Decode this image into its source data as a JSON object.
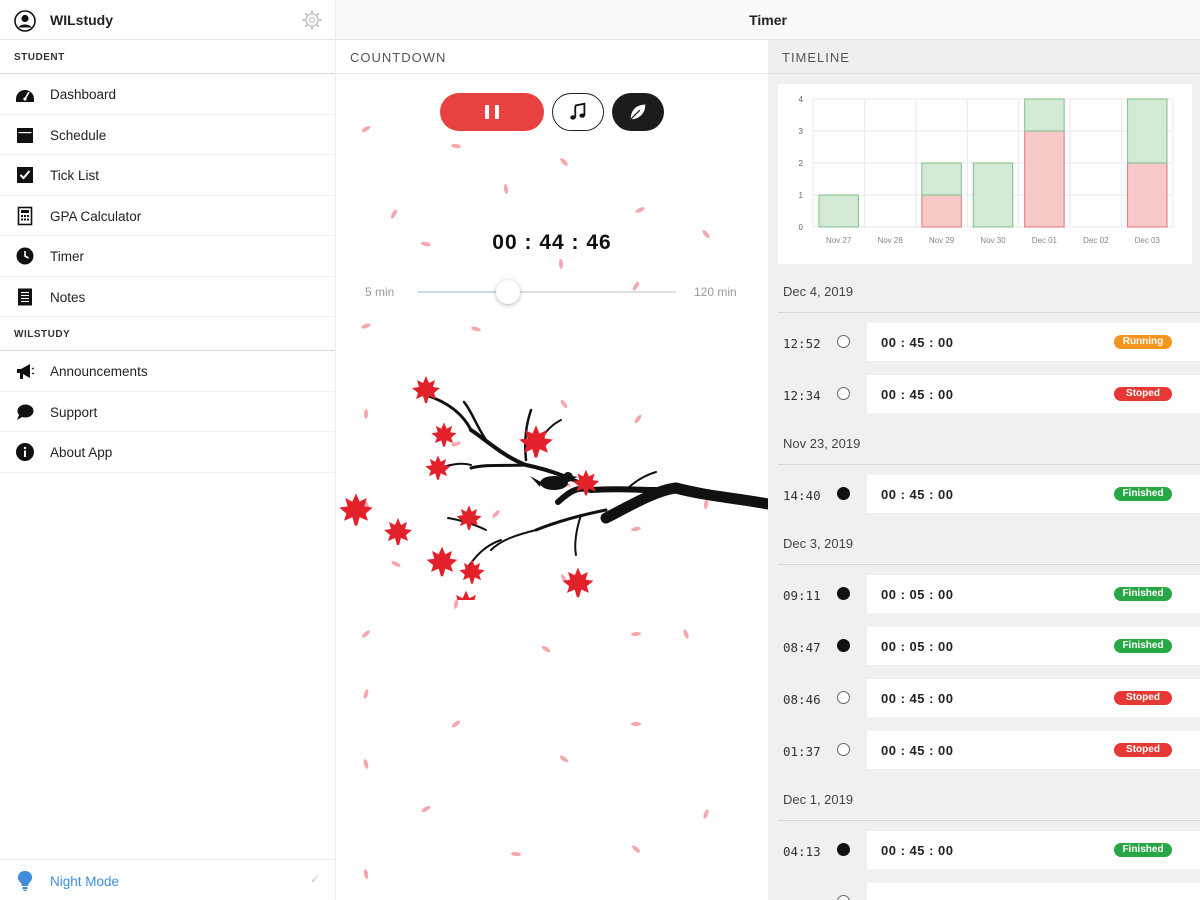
{
  "sidebar": {
    "app_name": "WILstudy",
    "sections": [
      {
        "label": "STUDENT",
        "items": [
          {
            "label": "Dashboard",
            "icon": "dashboard-icon"
          },
          {
            "label": "Schedule",
            "icon": "calendar-icon"
          },
          {
            "label": "Tick List",
            "icon": "checkbox-icon"
          },
          {
            "label": "GPA Calculator",
            "icon": "calculator-icon"
          },
          {
            "label": "Timer",
            "icon": "clock-icon"
          },
          {
            "label": "Notes",
            "icon": "notes-icon"
          }
        ]
      },
      {
        "label": "WILSTUDY",
        "items": [
          {
            "label": "Announcements",
            "icon": "megaphone-icon"
          },
          {
            "label": "Support",
            "icon": "chat-bubble-icon"
          },
          {
            "label": "About App",
            "icon": "info-icon"
          }
        ]
      }
    ],
    "night_mode": {
      "label": "Night Mode",
      "icon": "lightbulb-icon",
      "checked": false
    }
  },
  "topbar": {
    "title": "Timer"
  },
  "countdown": {
    "label": "COUNTDOWN",
    "time": "00 : 44 : 46",
    "slider": {
      "min_label": "5 min",
      "max_label": "120 min",
      "min": 5,
      "max": 120,
      "value": 45
    },
    "buttons": {
      "pause": "pause-icon",
      "music": "music-note-icon",
      "theme": "leaf-icon"
    }
  },
  "timeline": {
    "label": "TIMELINE",
    "colors": {
      "finished": "#28a745",
      "stopped": "#e53935",
      "running": "#f7941d"
    },
    "days": [
      {
        "date": "Dec 4, 2019",
        "entries": [
          {
            "time": "12:52",
            "duration": "00 : 45 : 00",
            "status": "Running",
            "dot": "empty"
          },
          {
            "time": "12:34",
            "duration": "00 : 45 : 00",
            "status": "Stoped",
            "dot": "empty"
          }
        ]
      },
      {
        "date": "Nov 23, 2019",
        "entries": [
          {
            "time": "14:40",
            "duration": "00 : 45 : 00",
            "status": "Finished",
            "dot": "filled"
          }
        ]
      },
      {
        "date": "Dec 3, 2019",
        "entries": [
          {
            "time": "09:11",
            "duration": "00 : 05 : 00",
            "status": "Finished",
            "dot": "filled"
          },
          {
            "time": "08:47",
            "duration": "00 : 05 : 00",
            "status": "Finished",
            "dot": "filled"
          },
          {
            "time": "08:46",
            "duration": "00 : 45 : 00",
            "status": "Stoped",
            "dot": "empty"
          },
          {
            "time": "01:37",
            "duration": "00 : 45 : 00",
            "status": "Stoped",
            "dot": "empty"
          }
        ]
      },
      {
        "date": "Dec 1, 2019",
        "entries": [
          {
            "time": "04:13",
            "duration": "00 : 45 : 00",
            "status": "Finished",
            "dot": "filled"
          },
          {
            "time": "",
            "duration": "",
            "status": "",
            "dot": "empty"
          }
        ]
      }
    ]
  },
  "chart_data": {
    "type": "bar",
    "stacked": true,
    "categories": [
      "Nov 27",
      "Nov 28",
      "Nov 29",
      "Nov 30",
      "Dec 01",
      "Dec 02",
      "Dec 03"
    ],
    "series": [
      {
        "values": [
          0,
          0,
          1,
          0,
          3,
          0,
          2
        ],
        "color": "#f8c9c9",
        "stroke": "#e57373"
      },
      {
        "values": [
          1,
          0,
          1,
          2,
          1,
          0,
          2
        ],
        "color": "#d3ead6",
        "stroke": "#7fbf8a"
      }
    ],
    "ylim": [
      0,
      4
    ],
    "yticks": [
      "0",
      "1",
      "2",
      "3",
      "4"
    ],
    "grid": true,
    "title": "",
    "xlabel": "",
    "ylabel": ""
  }
}
